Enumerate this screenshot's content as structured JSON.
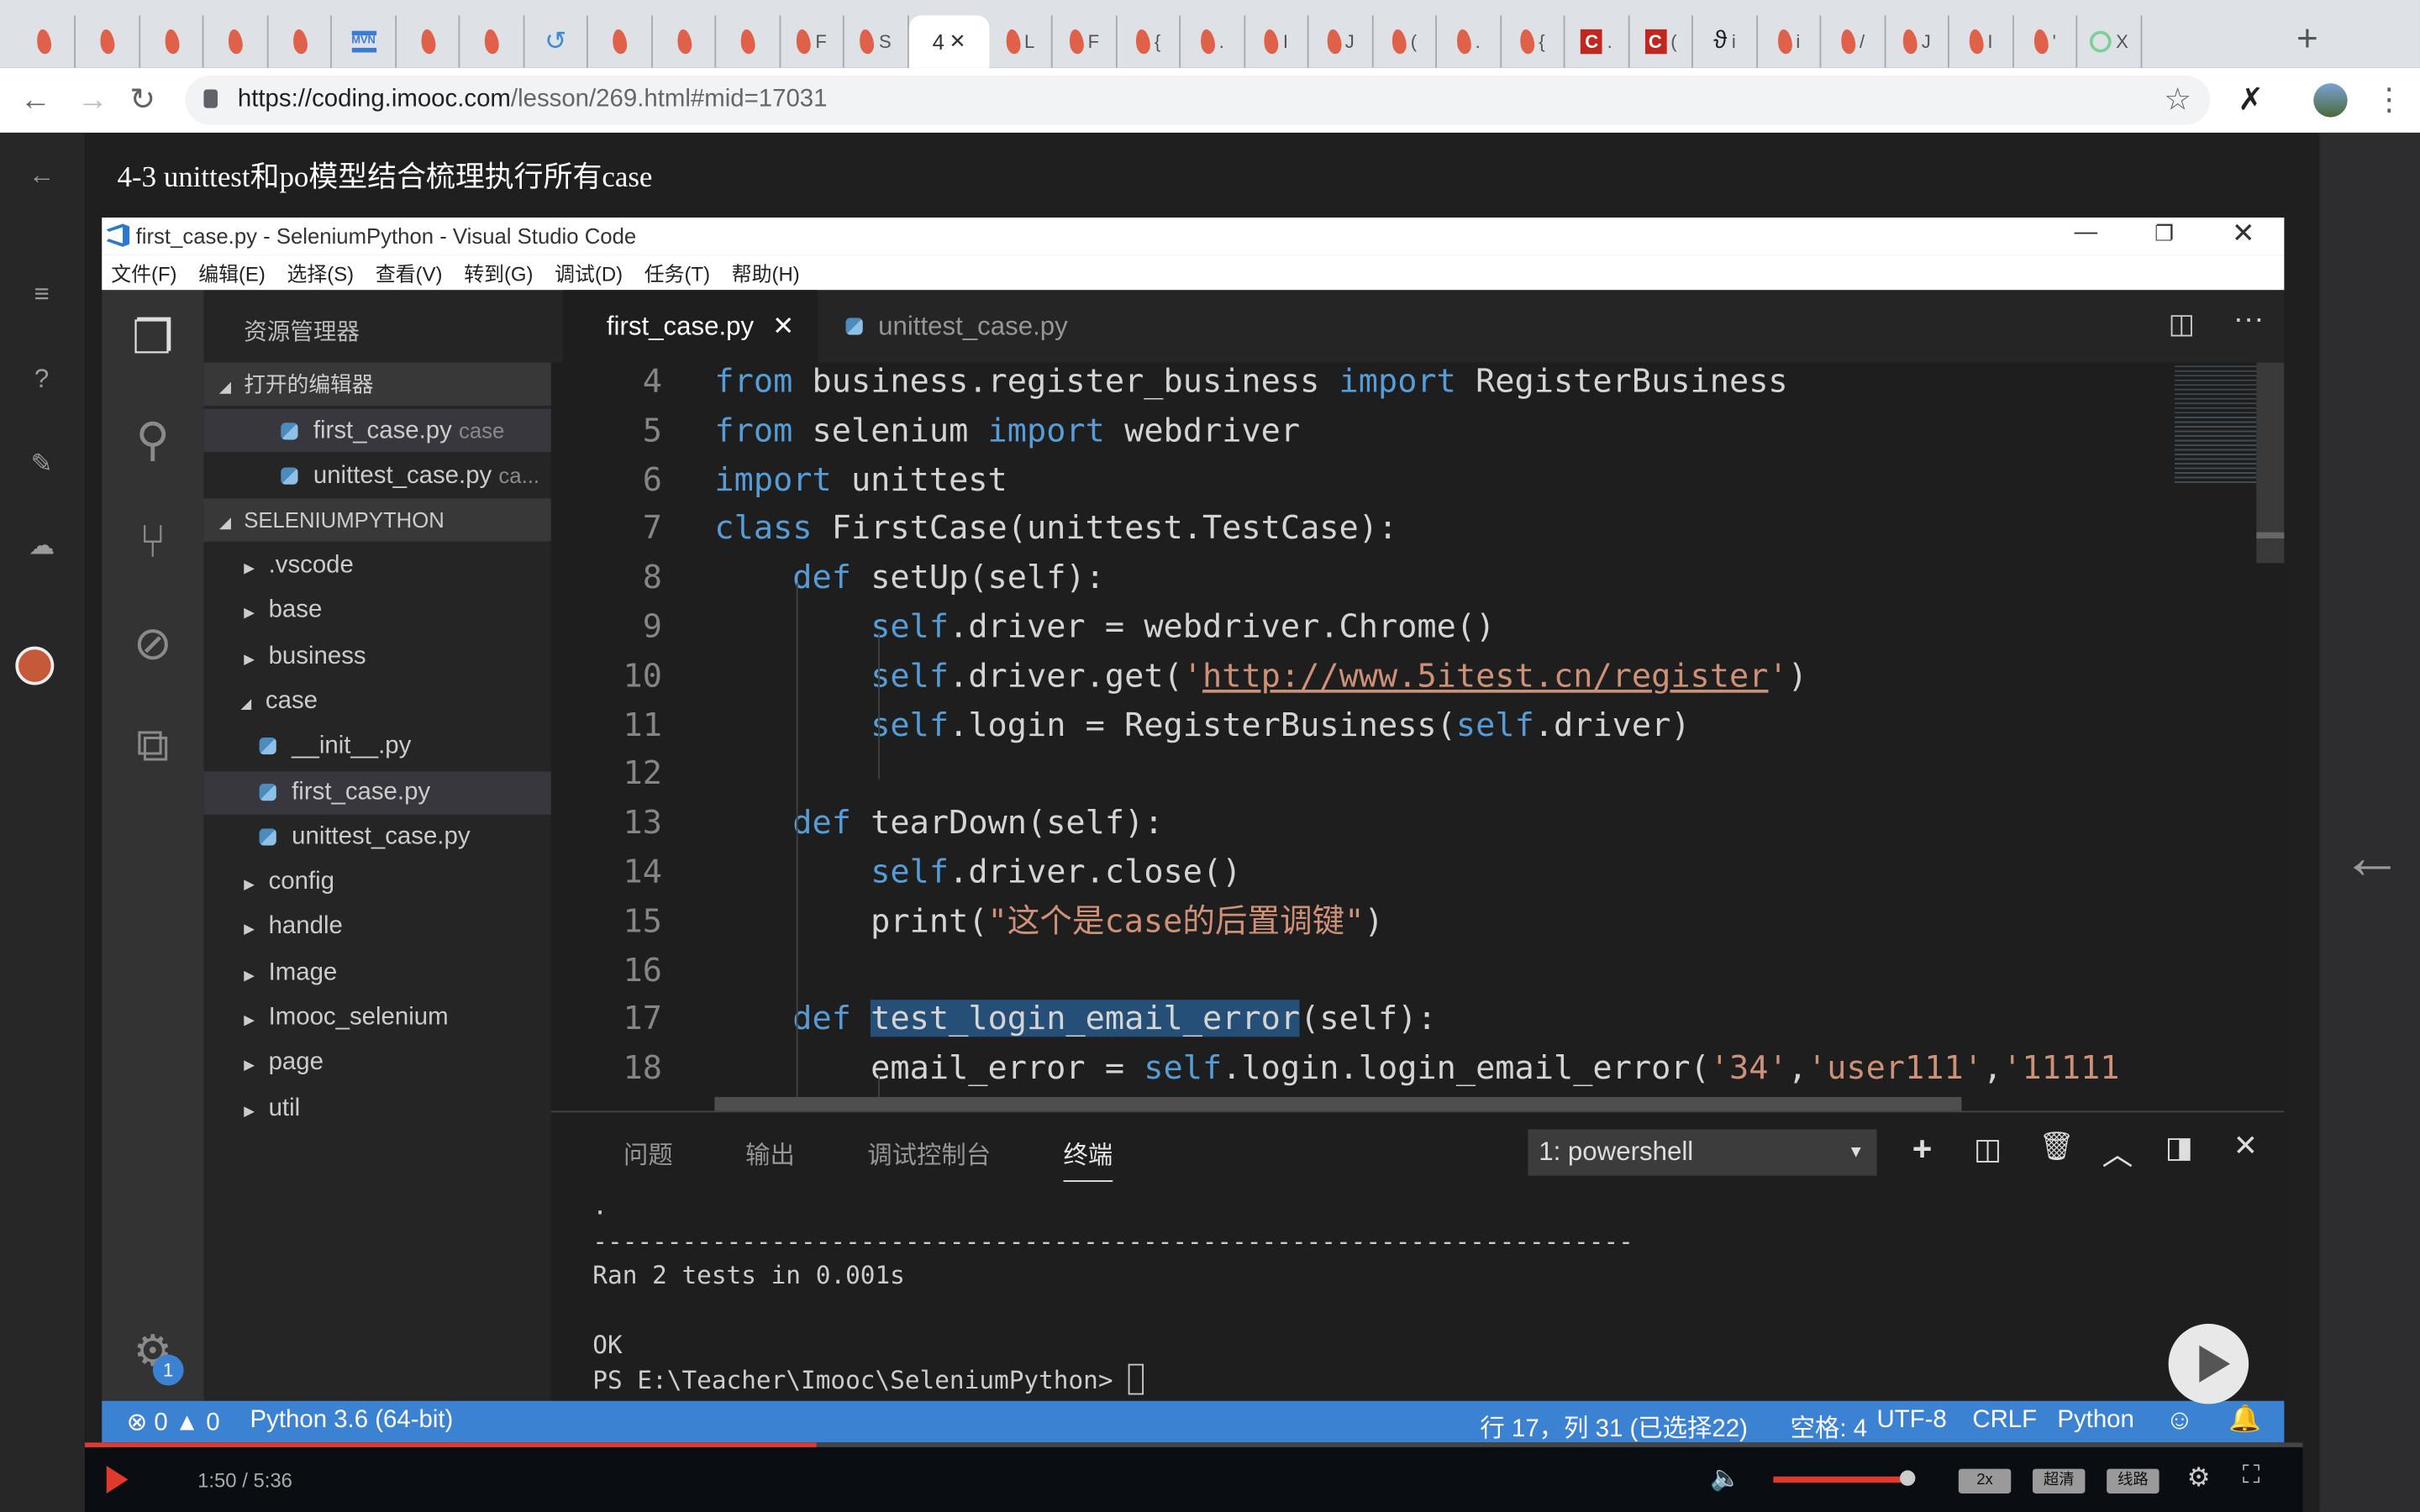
{
  "browser": {
    "tabs": [
      {
        "icon": "flame",
        "label": ""
      },
      {
        "icon": "flame",
        "label": ""
      },
      {
        "icon": "flame",
        "label": ""
      },
      {
        "icon": "flame",
        "label": ""
      },
      {
        "icon": "flame",
        "label": ""
      },
      {
        "icon": "mvn",
        "label": ""
      },
      {
        "icon": "flame",
        "label": ""
      },
      {
        "icon": "flame",
        "label": ""
      },
      {
        "icon": "refresh",
        "label": ""
      },
      {
        "icon": "flame",
        "label": ""
      },
      {
        "icon": "flame",
        "label": ""
      },
      {
        "icon": "flame",
        "label": ""
      },
      {
        "icon": "flame",
        "label": "F"
      },
      {
        "icon": "flame",
        "label": "S"
      },
      {
        "icon": "none",
        "label": "4",
        "active": true
      },
      {
        "icon": "flame",
        "label": "L"
      },
      {
        "icon": "flame",
        "label": "F"
      },
      {
        "icon": "flame",
        "label": "{"
      },
      {
        "icon": "flame",
        "label": "."
      },
      {
        "icon": "flame",
        "label": "I"
      },
      {
        "icon": "flame",
        "label": "J"
      },
      {
        "icon": "flame",
        "label": "("
      },
      {
        "icon": "flame",
        "label": "."
      },
      {
        "icon": "flame",
        "label": "{"
      },
      {
        "icon": "c",
        "label": "."
      },
      {
        "icon": "c",
        "label": "("
      },
      {
        "icon": "theta",
        "label": "i"
      },
      {
        "icon": "flame",
        "label": "i"
      },
      {
        "icon": "flame",
        "label": "/"
      },
      {
        "icon": "flame",
        "label": "J"
      },
      {
        "icon": "flame",
        "label": "I"
      },
      {
        "icon": "flame",
        "label": "'"
      },
      {
        "icon": "green",
        "label": "X"
      }
    ],
    "url_host": "https://coding.imooc.com",
    "url_path": "/lesson/269.html#mid=17031"
  },
  "lesson_title": "4-3 unittest和po模型结合梳理执行所有case",
  "vscode": {
    "title": "first_case.py - SeleniumPython - Visual Studio Code",
    "menu": [
      "文件(F)",
      "编辑(E)",
      "选择(S)",
      "查看(V)",
      "转到(G)",
      "调试(D)",
      "任务(T)",
      "帮助(H)"
    ],
    "explorer_title": "资源管理器",
    "open_editors_label": "打开的编辑器",
    "open_editors": [
      {
        "name": "first_case.py",
        "hint": "case"
      },
      {
        "name": "unittest_case.py",
        "hint": "ca..."
      }
    ],
    "project_label": "SELENIUMPYTHON",
    "tree": [
      {
        "name": ".vscode",
        "type": "folder",
        "depth": 0
      },
      {
        "name": "base",
        "type": "folder",
        "depth": 0
      },
      {
        "name": "business",
        "type": "folder",
        "depth": 0
      },
      {
        "name": "case",
        "type": "folder-open",
        "depth": 0
      },
      {
        "name": "__init__.py",
        "type": "file",
        "depth": 1
      },
      {
        "name": "first_case.py",
        "type": "file",
        "depth": 1,
        "selected": true
      },
      {
        "name": "unittest_case.py",
        "type": "file",
        "depth": 1
      },
      {
        "name": "config",
        "type": "folder",
        "depth": 0
      },
      {
        "name": "handle",
        "type": "folder",
        "depth": 0
      },
      {
        "name": "Image",
        "type": "folder",
        "depth": 0
      },
      {
        "name": "Imooc_selenium",
        "type": "folder",
        "depth": 0
      },
      {
        "name": "page",
        "type": "folder",
        "depth": 0
      },
      {
        "name": "util",
        "type": "folder",
        "depth": 0
      }
    ],
    "editor_tabs": [
      {
        "name": "first_case.py",
        "active": true
      },
      {
        "name": "unittest_case.py"
      }
    ],
    "code": [
      {
        "n": 4,
        "t": [
          [
            "from",
            "k"
          ],
          " business.register_business ",
          [
            "import",
            "k"
          ],
          " RegisterBusiness"
        ]
      },
      {
        "n": 5,
        "t": [
          [
            "from",
            "k"
          ],
          " selenium ",
          [
            "import",
            "k"
          ],
          " webdriver"
        ]
      },
      {
        "n": 6,
        "t": [
          [
            "import",
            "k"
          ],
          " unittest"
        ]
      },
      {
        "n": 7,
        "t": [
          [
            "class",
            "k"
          ],
          " FirstCase(unittest.TestCase):"
        ]
      },
      {
        "n": 8,
        "t": [
          "    ",
          [
            "def",
            "k"
          ],
          " setUp(self):"
        ]
      },
      {
        "n": 9,
        "t": [
          "        ",
          [
            "self",
            "k"
          ],
          ".driver = webdriver.Chrome()"
        ]
      },
      {
        "n": 10,
        "t": [
          "        ",
          [
            "self",
            "k"
          ],
          ".driver.get(",
          [
            "'",
            "s"
          ],
          [
            "http://www.5itest.cn/register",
            "u"
          ],
          [
            "'",
            "s"
          ],
          ")"
        ]
      },
      {
        "n": 11,
        "t": [
          "        ",
          [
            "self",
            "k"
          ],
          ".login = RegisterBusiness(",
          [
            "self",
            "k"
          ],
          ".driver)"
        ]
      },
      {
        "n": 12,
        "t": []
      },
      {
        "n": 13,
        "t": [
          "    ",
          [
            "def",
            "k"
          ],
          " tearDown(self):"
        ]
      },
      {
        "n": 14,
        "t": [
          "        ",
          [
            "self",
            "k"
          ],
          ".driver.close()"
        ]
      },
      {
        "n": 15,
        "t": [
          "        print(",
          [
            "\"这个是case的后置调键\"",
            "s"
          ],
          ")"
        ]
      },
      {
        "n": 16,
        "t": []
      },
      {
        "n": 17,
        "t": [
          "    ",
          [
            "def",
            "k"
          ],
          " ",
          [
            "test_login_email_error",
            "hl"
          ],
          "(self):"
        ]
      },
      {
        "n": 18,
        "t": [
          "        email_error = ",
          [
            "self",
            "k"
          ],
          ".login.login_email_error(",
          [
            "'34'",
            "s"
          ],
          ",",
          [
            "'user111'",
            "s"
          ],
          ",",
          [
            "'11111",
            "s"
          ]
        ]
      }
    ],
    "panel_tabs": [
      "问题",
      "输出",
      "调试控制台",
      "终端"
    ],
    "terminal_select": "1: powershell",
    "terminal_lines": [
      ".",
      "----------------------------------------------------------------------",
      "Ran 2 tests in 0.001s",
      "",
      "OK",
      "PS E:\\Teacher\\Imooc\\SeleniumPython> "
    ],
    "status": {
      "errors": "0",
      "warnings": "0",
      "interpreter": "Python 3.6 (64-bit)",
      "position": "行 17，列 31 (已选择22)",
      "spaces": "空格: 4",
      "encoding": "UTF-8",
      "eol": "CRLF",
      "language": "Python"
    },
    "settings_badge": "1",
    "accent": "#3c82d2"
  },
  "player": {
    "time": "1:50 / 5:36",
    "progress": 0.33,
    "volume": 1.0,
    "speed": "2x",
    "quality": "超清",
    "line": "线路",
    "progress_color": "#e03a2f"
  }
}
